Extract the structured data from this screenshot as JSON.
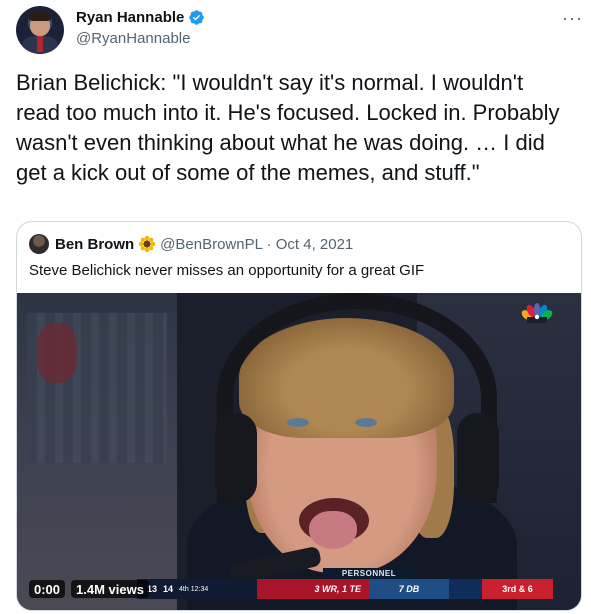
{
  "author": {
    "name": "Ryan Hannable",
    "handle": "@RyanHannable",
    "verified": true
  },
  "tweet": {
    "text": "Brian Belichick: \"I wouldn't say it's normal. I wouldn't read too much into it. He's focused. Locked in. Probably wasn't even thinking about what he was doing. … I did get a kick out of some of the memes, and stuff.\""
  },
  "quoted": {
    "name": "Ben Brown",
    "emoji": "sunflower",
    "handle_date": "@BenBrownPL · Oct 4, 2021",
    "text": "Steve Belichick never misses an opportunity for a great GIF",
    "video": {
      "time": "0:00",
      "views": "1.4M views",
      "score_left": "13",
      "score_right": "14",
      "quarter": "4th",
      "clock": "12:34",
      "personnel_label": "PERSONNEL",
      "offense": "3 WR, 1 TE",
      "defense": "7 DB",
      "down": "3rd & 6"
    }
  },
  "colors": {
    "accent": "#1d9bf0",
    "text": "#0f1419",
    "secondary": "#536471",
    "border": "#cfd9de"
  },
  "icons": [
    "verified-badge-icon",
    "more-options-icon",
    "sunflower-icon",
    "nbc-peacock-icon"
  ]
}
